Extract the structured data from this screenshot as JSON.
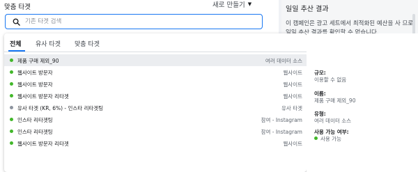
{
  "left_panel": {
    "title": "맞춤 타겟",
    "new_button": {
      "label": "새로 만들기",
      "caret": "▼"
    },
    "search": {
      "placeholder": "기존 타겟 검색",
      "value": "",
      "icon": "search-icon"
    }
  },
  "dropdown": {
    "tabs": [
      {
        "label": "전체",
        "active": true
      },
      {
        "label": "유사 타겟",
        "active": false
      },
      {
        "label": "맞춤 타겟",
        "active": false
      }
    ],
    "rows": [
      {
        "name": "제품 구매 제외_90",
        "source": "여러 데이터 소스",
        "status_color": "#42b72a",
        "highlighted": true
      },
      {
        "name": "웹사이트 방문자",
        "source": "웹사이트",
        "status_color": "#42b72a",
        "highlighted": false
      },
      {
        "name": "웹사이트 방문자",
        "source": "웹사이트",
        "status_color": "#42b72a",
        "highlighted": false
      },
      {
        "name": "웹사이트 방문자 리타겟",
        "source": "웹사이트",
        "status_color": "#42b72a",
        "highlighted": false
      },
      {
        "name": "유사 타겟 (KR, 6%) - 인스타 리타겟팅",
        "source": "유사 타겟",
        "status_color": "#8d949e",
        "highlighted": false
      },
      {
        "name": "인스타 리타겟팅",
        "source": "참여 - Instagram",
        "status_color": "#42b72a",
        "highlighted": false
      },
      {
        "name": "인스타 리타겟팅",
        "source": "참여 - Instagram",
        "status_color": "#42b72a",
        "highlighted": false
      },
      {
        "name": "웹사이트 방문자 리타겟",
        "source": "웹사이트",
        "status_color": "#42b72a",
        "highlighted": false
      }
    ]
  },
  "info_panel": {
    "size_label": "규모:",
    "size_value": "이용할 수 없음",
    "name_label": "이름:",
    "name_value": "제품 구매 제외_90",
    "type_label": "유형:",
    "type_value": "여러 데이터 소스",
    "availability_label": "사용 가능 여부:",
    "availability_value": "사용 가능",
    "availability_color": "#42b72a"
  },
  "right_panel": {
    "title": "일일 추산 결과",
    "body": "이 캠페인은 광고 세트에서 최적화된 예산을 사 므로 일일 추산 결과를 확인할 수 없습니다."
  }
}
